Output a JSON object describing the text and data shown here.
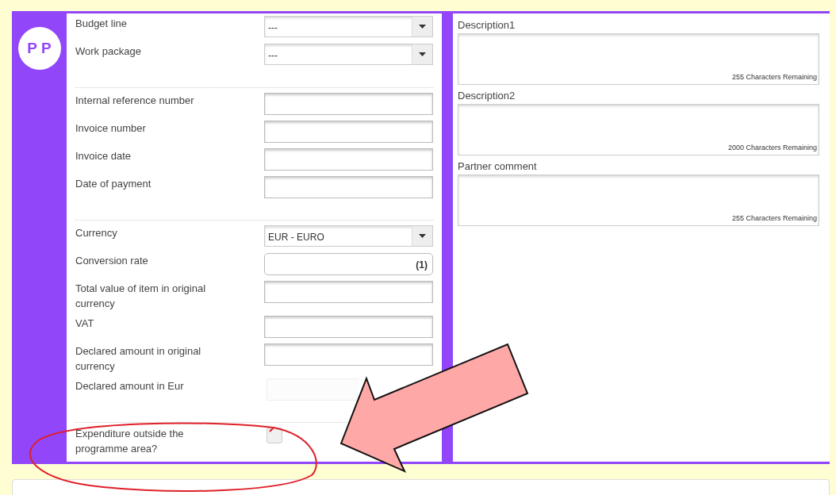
{
  "avatar": {
    "initials": "P P"
  },
  "groups": [
    {
      "fields": [
        {
          "kind": "select",
          "label": "Budget line",
          "value": "---"
        },
        {
          "kind": "select",
          "label": "Work package",
          "value": "---"
        }
      ]
    },
    {
      "fields": [
        {
          "kind": "text",
          "label": "Internal reference number",
          "disabled": false
        },
        {
          "kind": "text",
          "label": "Invoice number",
          "disabled": false
        },
        {
          "kind": "text",
          "label": "Invoice date",
          "disabled": false
        },
        {
          "kind": "text",
          "label": "Date of payment",
          "disabled": false
        }
      ]
    },
    {
      "fields": [
        {
          "kind": "select",
          "label": "Currency",
          "value": "EUR - EURO"
        },
        {
          "kind": "number",
          "label": "Conversion rate",
          "value": "(1)"
        },
        {
          "kind": "text",
          "label": "Total value of item in original currency",
          "disabled": false
        },
        {
          "kind": "text",
          "label": "VAT",
          "disabled": false
        },
        {
          "kind": "text",
          "label": "Declared amount in original currency",
          "disabled": false
        },
        {
          "kind": "text",
          "label": "Declared amount in Eur",
          "disabled": true
        }
      ]
    },
    {
      "fields": [
        {
          "kind": "checkbox",
          "label": "Expenditure outside the programme area?",
          "checked": false
        }
      ]
    }
  ],
  "text_areas": [
    {
      "label": "Description1",
      "counter": "255 Characters Remaining"
    },
    {
      "label": "Description2",
      "counter": "2000 Characters Remaining"
    },
    {
      "label": "Partner comment",
      "counter": "255 Characters Remaining"
    }
  ]
}
